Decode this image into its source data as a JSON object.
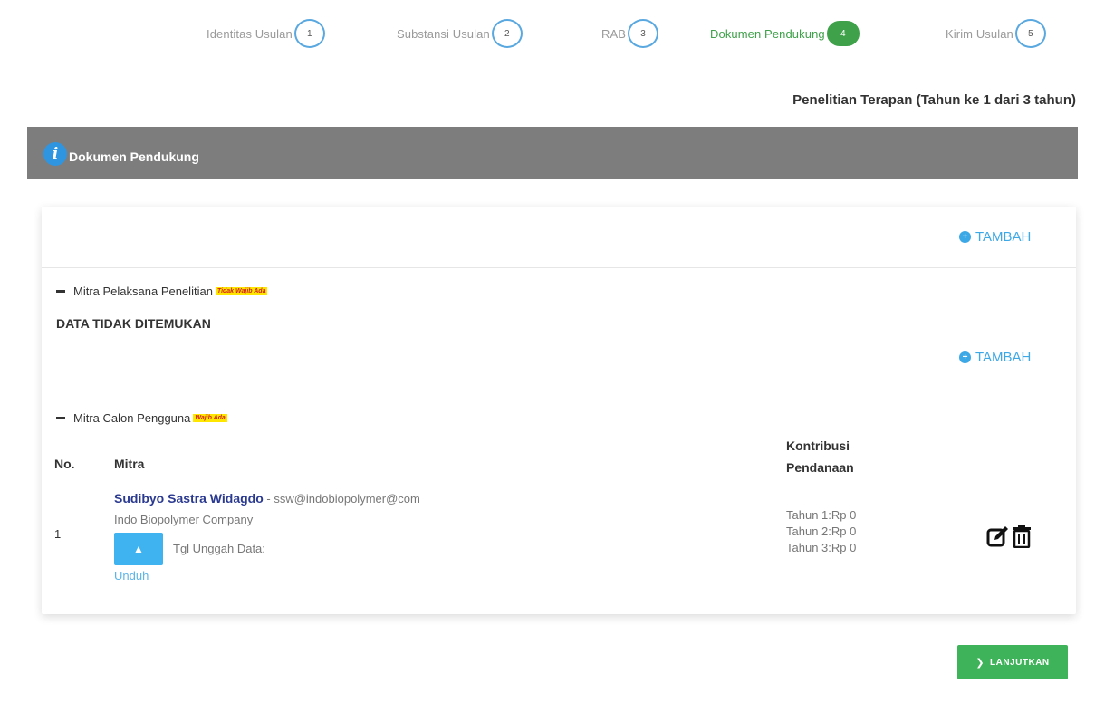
{
  "stepper": {
    "steps": [
      {
        "label": "Identitas Usulan",
        "num": "1"
      },
      {
        "label": "Substansi Usulan",
        "num": "2"
      },
      {
        "label": "RAB",
        "num": "3"
      },
      {
        "label": "Dokumen Pendukung",
        "num": "4",
        "active": true
      },
      {
        "label": "Kirim Usulan",
        "num": "5"
      }
    ]
  },
  "program_title": "Penelitian Terapan (Tahun ke 1 dari 3 tahun)",
  "section": {
    "title": "Dokumen Pendukung",
    "icon": "info-icon"
  },
  "card": {
    "tambah_label": "TAMBAH",
    "mitra_pelaksana": {
      "title": "Mitra Pelaksana Penelitian",
      "badge": "Tidak Wajib Ada",
      "empty_text": "DATA TIDAK DITEMUKAN",
      "tambah_label": "TAMBAH"
    },
    "mitra_calon": {
      "title": "Mitra Calon Pengguna",
      "badge": "Wajib Ada",
      "col_no": "No.",
      "col_mitra": "Mitra",
      "col_kontribusi_1": "Kontribusi",
      "col_kontribusi_2": "Pendanaan",
      "rows": [
        {
          "no": "1",
          "name": "Sudibyo Sastra Widagdo",
          "email": " - ssw@indobiopolymer@com",
          "company": "Indo Biopolymer Company",
          "upload_label": "Tgl Unggah Data:",
          "unduh": "Unduh",
          "kontribusi": [
            "Tahun 1:Rp 0",
            "Tahun 2:Rp 0",
            "Tahun 3:Rp 0"
          ]
        }
      ]
    }
  },
  "lanjutkan_label": "LANJUTKAN",
  "colors": {
    "active_step": "#3fa14a",
    "step_border": "#5aa8e0",
    "header_bg": "#7d7d7d",
    "link": "#3da8e6",
    "button_green": "#3fb35a"
  }
}
